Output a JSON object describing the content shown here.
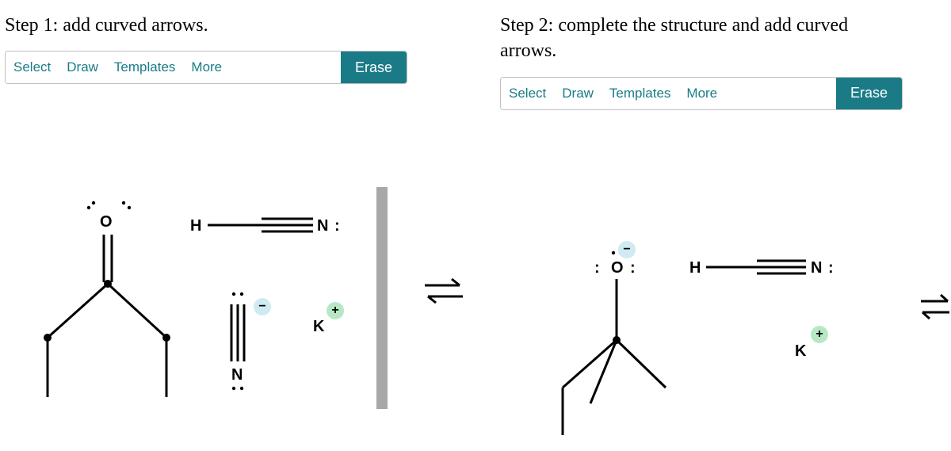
{
  "step1": {
    "title": "Step 1: add curved arrows.",
    "toolbar": {
      "select": "Select",
      "draw": "Draw",
      "templates": "Templates",
      "more": "More",
      "erase": "Erase"
    },
    "atoms": {
      "O": "O",
      "H": "H",
      "N_top": "N",
      "N_lonepair_top": ":",
      "N_bottom": "N",
      "K": "K",
      "K_charge": "+",
      "CN_charge": "−"
    }
  },
  "step2": {
    "title": "Step 2: complete the structure and add curved arrows.",
    "toolbar": {
      "select": "Select",
      "draw": "Draw",
      "templates": "Templates",
      "more": "More",
      "erase": "Erase"
    },
    "atoms": {
      "O": "O",
      "O_lonepair_left": ":",
      "O_lonepair_right": ":",
      "O_charge": "−",
      "H": "H",
      "N": "N",
      "N_lonepair": ":",
      "K": "K",
      "K_charge": "+"
    }
  },
  "equilibrium_glyph": "⇌"
}
